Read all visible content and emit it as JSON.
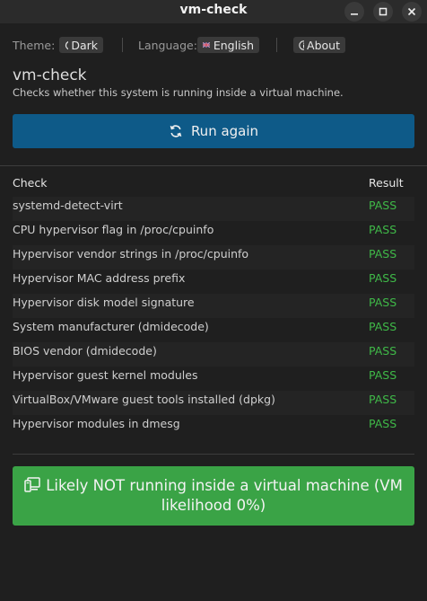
{
  "window": {
    "title": "vm-check",
    "controls": [
      "minimize",
      "maximize",
      "close"
    ]
  },
  "topbar": {
    "theme_label": "Theme:",
    "theme_value": "Dark",
    "theme_icon": "moon-icon",
    "language_label": "Language:",
    "language_value": "English",
    "language_icon": "uk-flag-icon",
    "about_label": "About",
    "about_icon": "info-icon"
  },
  "header": {
    "title": "vm-check",
    "subtitle": "Checks whether this system is running inside a virtual machine."
  },
  "run_button": {
    "label": "Run again",
    "icon": "refresh-icon",
    "color": "#0e5a88"
  },
  "table": {
    "headers": {
      "check": "Check",
      "result": "Result"
    },
    "rows": [
      {
        "check": "systemd-detect-virt",
        "result": "PASS"
      },
      {
        "check": "CPU hypervisor flag in /proc/cpuinfo",
        "result": "PASS"
      },
      {
        "check": "Hypervisor vendor strings in /proc/cpuinfo",
        "result": "PASS"
      },
      {
        "check": "Hypervisor MAC address prefix",
        "result": "PASS"
      },
      {
        "check": "Hypervisor disk model signature",
        "result": "PASS"
      },
      {
        "check": "System manufacturer (dmidecode)",
        "result": "PASS"
      },
      {
        "check": "BIOS vendor (dmidecode)",
        "result": "PASS"
      },
      {
        "check": "Hypervisor guest kernel modules",
        "result": "PASS"
      },
      {
        "check": "VirtualBox/VMware guest tools installed (dpkg)",
        "result": "PASS"
      },
      {
        "check": "Hypervisor modules in dmesg",
        "result": "PASS"
      }
    ],
    "pass_color": "#3fb948"
  },
  "verdict": {
    "text": "Likely NOT running inside a virtual machine (VM likelihood 0%)",
    "icon": "desktop-icon",
    "color": "#3aa346"
  }
}
